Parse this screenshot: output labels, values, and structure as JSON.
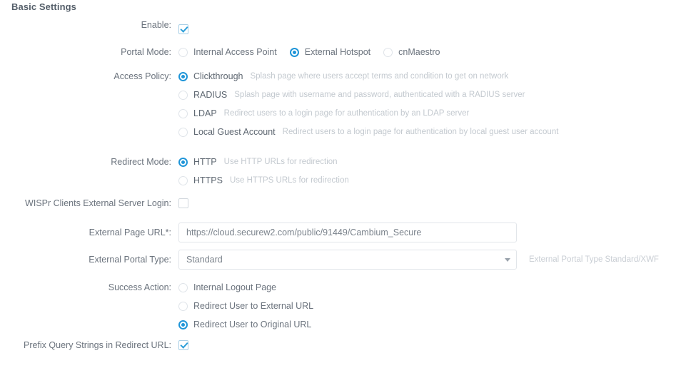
{
  "section": {
    "title": "Basic Settings"
  },
  "fields": {
    "enable": {
      "label": "Enable:",
      "checked": true
    },
    "portal_mode": {
      "label": "Portal Mode:",
      "options": [
        {
          "label": "Internal Access Point",
          "selected": false
        },
        {
          "label": "External Hotspot",
          "selected": true
        },
        {
          "label": "cnMaestro",
          "selected": false
        }
      ]
    },
    "access_policy": {
      "label": "Access Policy:",
      "options": [
        {
          "label": "Clickthrough",
          "description": "Splash page where users accept terms and condition to get on network",
          "selected": true
        },
        {
          "label": "RADIUS",
          "description": "Splash page with username and password, authenticated with a RADIUS server",
          "selected": false
        },
        {
          "label": "LDAP",
          "description": "Redirect users to a login page for authentication by an LDAP server",
          "selected": false
        },
        {
          "label": "Local Guest Account",
          "description": "Redirect users to a login page for authentication by local guest user account",
          "selected": false
        }
      ]
    },
    "redirect_mode": {
      "label": "Redirect Mode:",
      "options": [
        {
          "label": "HTTP",
          "description": "Use HTTP URLs for redirection",
          "selected": true
        },
        {
          "label": "HTTPS",
          "description": "Use HTTPS URLs for redirection",
          "selected": false
        }
      ]
    },
    "wispr_login": {
      "label": "WISPr Clients External Server Login:",
      "checked": false
    },
    "external_page_url": {
      "label": "External Page URL*:",
      "value": "https://cloud.securew2.com/public/91449/Cambium_Secure",
      "placeholder": ""
    },
    "external_portal_type": {
      "label": "External Portal Type:",
      "value": "Standard",
      "options": [
        "Standard",
        "XWF"
      ],
      "hint": "External Portal Type Standard/XWF"
    },
    "success_action": {
      "label": "Success Action:",
      "options": [
        {
          "label": "Internal Logout Page",
          "selected": false
        },
        {
          "label": "Redirect User to External URL",
          "selected": false
        },
        {
          "label": "Redirect User to Original URL",
          "selected": true
        }
      ]
    },
    "prefix_query_strings": {
      "label": "Prefix Query Strings in Redirect URL:",
      "checked": true
    }
  },
  "colors": {
    "accent": "#1f95d8",
    "label_text": "#6b737d",
    "description_text": "#c3c9cf",
    "border": "#e2e6ea"
  }
}
